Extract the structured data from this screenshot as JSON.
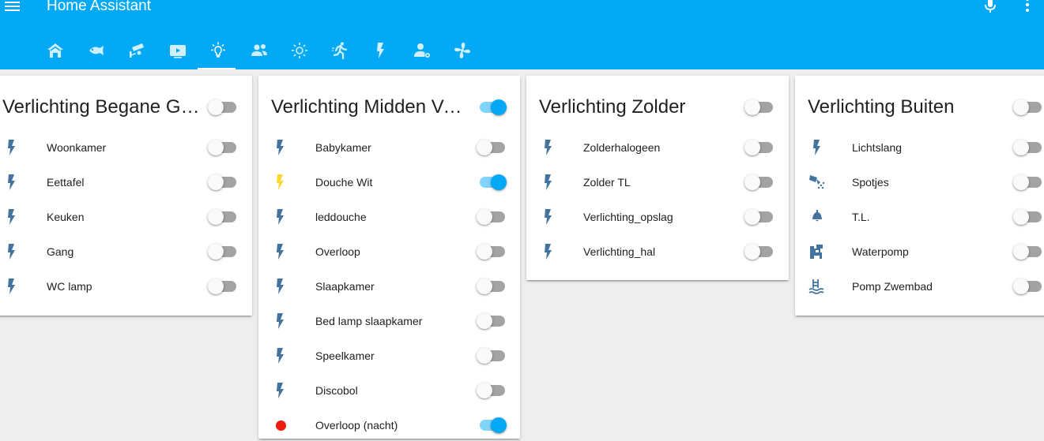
{
  "app": {
    "title": "Home Assistant"
  },
  "colors": {
    "accent": "#03a9f4",
    "icon": "#44739e",
    "icon_on": "#fdd835",
    "dot_red": "#ee1c10"
  },
  "tabs": [
    {
      "icon": "home-icon",
      "active": false
    },
    {
      "icon": "fish-icon",
      "active": false
    },
    {
      "icon": "security-camera-icon",
      "active": false
    },
    {
      "icon": "youtube-tv-icon",
      "active": false
    },
    {
      "icon": "lightbulb-on-icon",
      "active": true
    },
    {
      "icon": "account-multiple-icon",
      "active": false
    },
    {
      "icon": "sunny-icon",
      "active": false
    },
    {
      "icon": "run-icon",
      "active": false
    },
    {
      "icon": "flash-icon",
      "active": false
    },
    {
      "icon": "account-settings-icon",
      "active": false
    },
    {
      "icon": "fan-icon",
      "active": false
    }
  ],
  "cards": [
    {
      "title": "Verlichting Begane Grond",
      "on": false,
      "items": [
        {
          "label": "Woonkamer",
          "icon": "flash-icon",
          "on": false
        },
        {
          "label": "Eettafel",
          "icon": "flash-icon",
          "on": false
        },
        {
          "label": "Keuken",
          "icon": "flash-icon",
          "on": false
        },
        {
          "label": "Gang",
          "icon": "flash-icon",
          "on": false
        },
        {
          "label": "WC lamp",
          "icon": "flash-icon",
          "on": false
        }
      ]
    },
    {
      "title": "Verlichting Midden Verdieping",
      "on": true,
      "items": [
        {
          "label": "Babykamer",
          "icon": "flash-icon",
          "on": false
        },
        {
          "label": "Douche Wit",
          "icon": "flash-icon",
          "on": true
        },
        {
          "label": "leddouche",
          "icon": "flash-icon",
          "on": false
        },
        {
          "label": "Overloop",
          "icon": "flash-icon",
          "on": false
        },
        {
          "label": "Slaapkamer",
          "icon": "flash-icon",
          "on": false
        },
        {
          "label": "Bed lamp slaapkamer",
          "icon": "flash-icon",
          "on": false
        },
        {
          "label": "Speelkamer",
          "icon": "flash-icon",
          "on": false
        },
        {
          "label": "Discobol",
          "icon": "flash-icon",
          "on": false
        },
        {
          "label": "Overloop (nacht)",
          "icon": "red-dot-icon",
          "on": true
        }
      ]
    },
    {
      "title": "Verlichting Zolder",
      "on": false,
      "items": [
        {
          "label": "Zolderhalogeen",
          "icon": "flash-icon",
          "on": false
        },
        {
          "label": "Zolder TL",
          "icon": "flash-icon",
          "on": false
        },
        {
          "label": "Verlichting_opslag",
          "icon": "flash-icon",
          "on": false
        },
        {
          "label": "Verlichting_hal",
          "icon": "flash-icon",
          "on": false
        }
      ]
    },
    {
      "title": "Verlichting Buiten",
      "on": false,
      "items": [
        {
          "label": "Lichtslang",
          "icon": "flash-icon",
          "on": false
        },
        {
          "label": "Spotjes",
          "icon": "spotlight-beam-icon",
          "on": false
        },
        {
          "label": "T.L.",
          "icon": "ceiling-light-icon",
          "on": false
        },
        {
          "label": "Waterpomp",
          "icon": "water-pump-icon",
          "on": false
        },
        {
          "label": "Pomp Zwembad",
          "icon": "pool-icon",
          "on": false
        }
      ]
    }
  ]
}
